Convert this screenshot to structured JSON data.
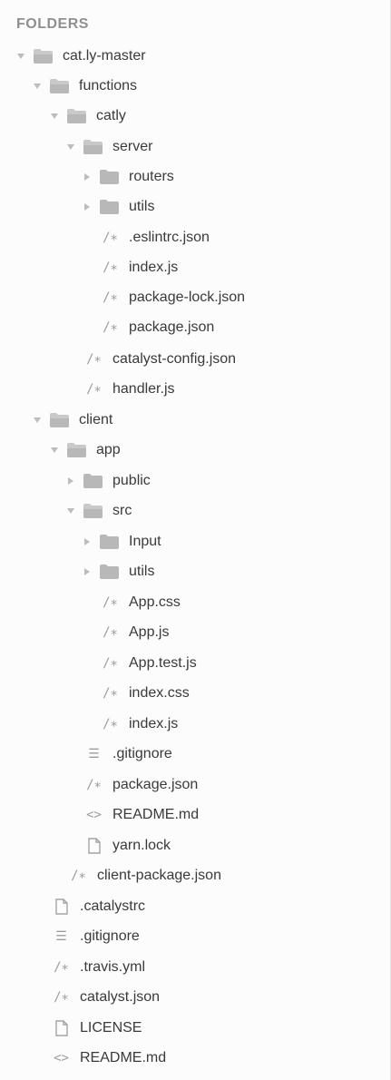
{
  "sidebar": {
    "title": "FOLDERS",
    "items": [
      {
        "label": "cat.ly-master",
        "kind": "folder",
        "state": "expanded",
        "icon": "folder-open-icon"
      },
      {
        "label": "functions",
        "kind": "folder",
        "state": "expanded",
        "icon": "folder-open-icon"
      },
      {
        "label": "catly",
        "kind": "folder",
        "state": "expanded",
        "icon": "folder-open-icon"
      },
      {
        "label": "server",
        "kind": "folder",
        "state": "expanded",
        "icon": "folder-open-icon"
      },
      {
        "label": "routers",
        "kind": "folder",
        "state": "collapsed",
        "icon": "folder-icon"
      },
      {
        "label": "utils",
        "kind": "folder",
        "state": "collapsed",
        "icon": "folder-icon"
      },
      {
        "label": ".eslintrc.json",
        "kind": "file",
        "icon": "comment-file-icon",
        "glyph": "/∗"
      },
      {
        "label": "index.js",
        "kind": "file",
        "icon": "comment-file-icon",
        "glyph": "/∗"
      },
      {
        "label": "package-lock.json",
        "kind": "file",
        "icon": "comment-file-icon",
        "glyph": "/∗"
      },
      {
        "label": "package.json",
        "kind": "file",
        "icon": "comment-file-icon",
        "glyph": "/∗"
      },
      {
        "label": "catalyst-config.json",
        "kind": "file",
        "icon": "comment-file-icon",
        "glyph": "/∗"
      },
      {
        "label": "handler.js",
        "kind": "file",
        "icon": "comment-file-icon",
        "glyph": "/∗"
      },
      {
        "label": "client",
        "kind": "folder",
        "state": "expanded",
        "icon": "folder-open-icon"
      },
      {
        "label": "app",
        "kind": "folder",
        "state": "expanded",
        "icon": "folder-open-icon"
      },
      {
        "label": "public",
        "kind": "folder",
        "state": "collapsed",
        "icon": "folder-icon"
      },
      {
        "label": "src",
        "kind": "folder",
        "state": "expanded",
        "icon": "folder-open-icon"
      },
      {
        "label": "Input",
        "kind": "folder",
        "state": "collapsed",
        "icon": "folder-icon"
      },
      {
        "label": "utils",
        "kind": "folder",
        "state": "collapsed",
        "icon": "folder-icon"
      },
      {
        "label": "App.css",
        "kind": "file",
        "icon": "comment-file-icon",
        "glyph": "/∗"
      },
      {
        "label": "App.js",
        "kind": "file",
        "icon": "comment-file-icon",
        "glyph": "/∗"
      },
      {
        "label": "App.test.js",
        "kind": "file",
        "icon": "comment-file-icon",
        "glyph": "/∗"
      },
      {
        "label": "index.css",
        "kind": "file",
        "icon": "comment-file-icon",
        "glyph": "/∗"
      },
      {
        "label": "index.js",
        "kind": "file",
        "icon": "comment-file-icon",
        "glyph": "/∗"
      },
      {
        "label": ".gitignore",
        "kind": "file",
        "icon": "list-file-icon",
        "glyph": "☰"
      },
      {
        "label": "package.json",
        "kind": "file",
        "icon": "comment-file-icon",
        "glyph": "/∗"
      },
      {
        "label": "README.md",
        "kind": "file",
        "icon": "code-file-icon",
        "glyph": "<>"
      },
      {
        "label": "yarn.lock",
        "kind": "file",
        "icon": "document-icon"
      },
      {
        "label": "client-package.json",
        "kind": "file",
        "icon": "comment-file-icon",
        "glyph": "/∗"
      },
      {
        "label": ".catalystrc",
        "kind": "file",
        "icon": "document-icon"
      },
      {
        "label": ".gitignore",
        "kind": "file",
        "icon": "list-file-icon",
        "glyph": "☰"
      },
      {
        "label": ".travis.yml",
        "kind": "file",
        "icon": "comment-file-icon",
        "glyph": "/∗"
      },
      {
        "label": "catalyst.json",
        "kind": "file",
        "icon": "comment-file-icon",
        "glyph": "/∗"
      },
      {
        "label": "LICENSE",
        "kind": "file",
        "icon": "document-icon"
      },
      {
        "label": "README.md",
        "kind": "file",
        "icon": "code-file-icon",
        "glyph": "<>"
      }
    ]
  },
  "colors": {
    "folder": "#b9b9b9",
    "folder_open": "#c8c8c8",
    "disclosure": "#b6b6b6",
    "text": "#3a3a3a",
    "title": "#8f8f8f"
  }
}
